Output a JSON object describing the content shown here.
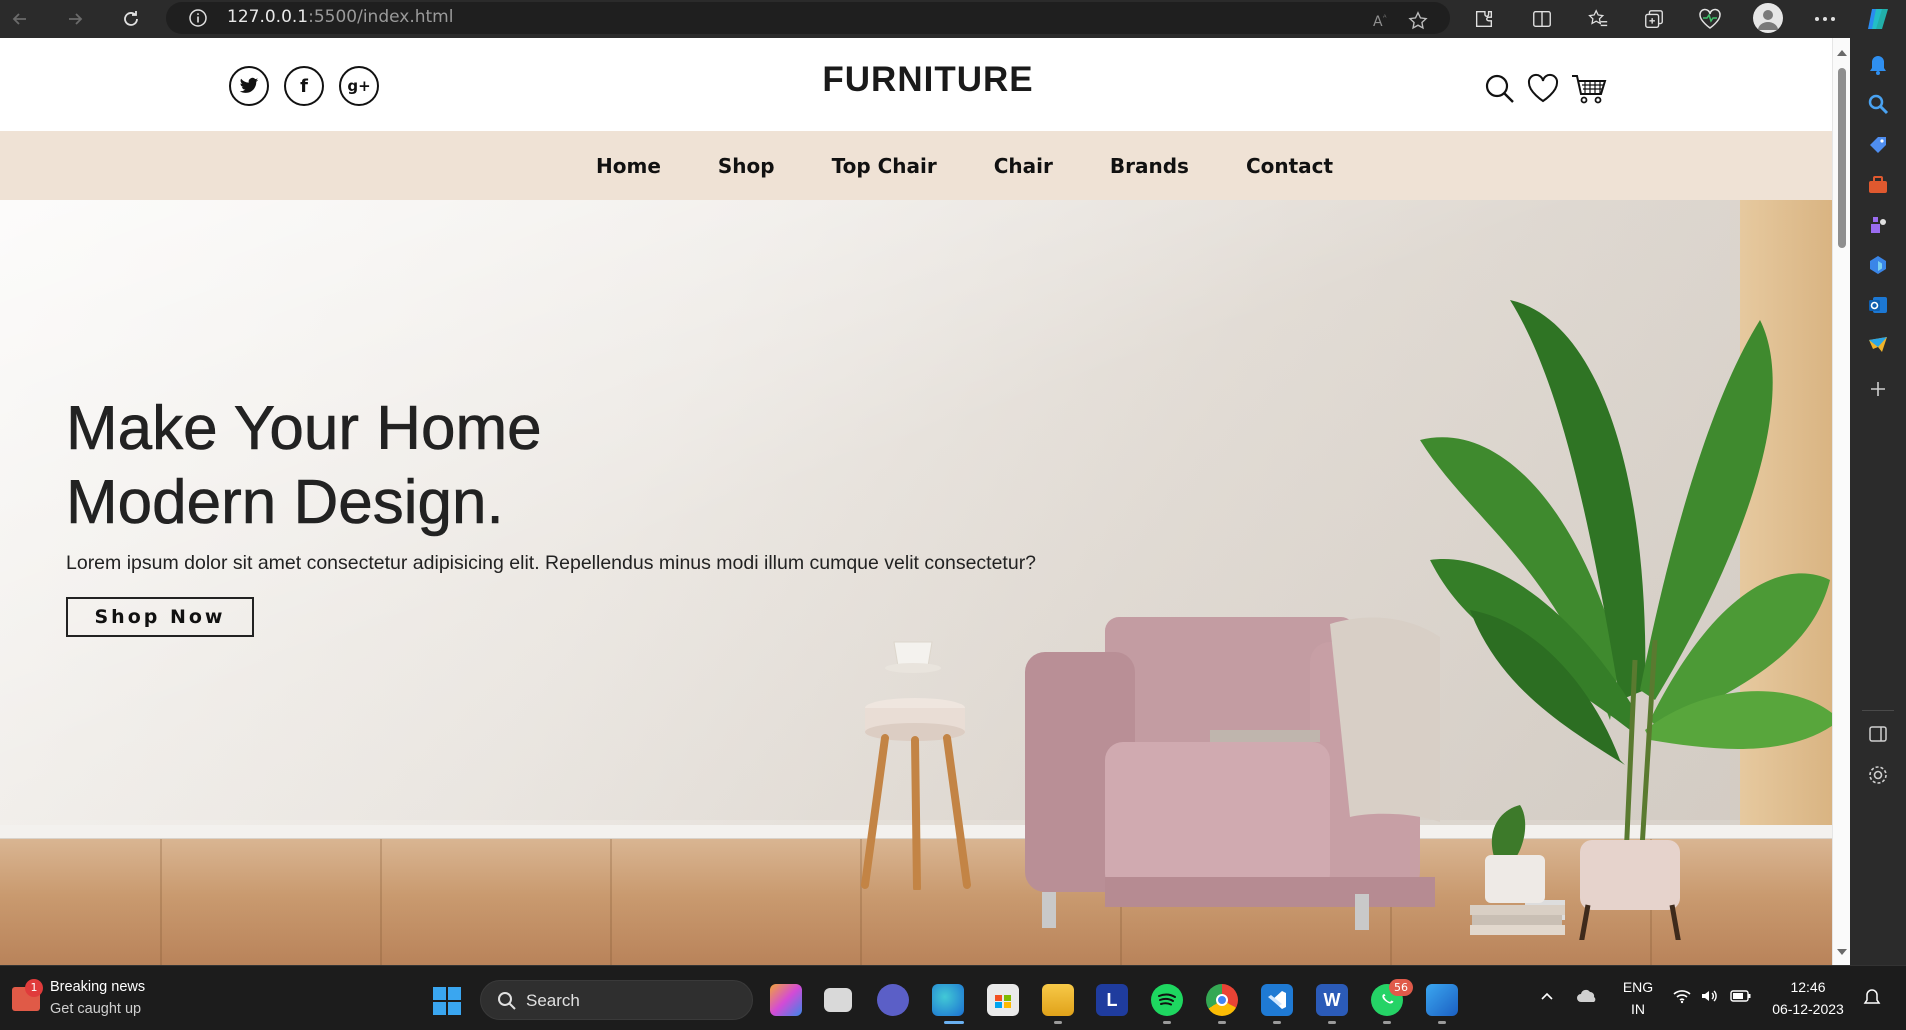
{
  "browser": {
    "url_host": "127.0.0.1",
    "url_rest": ":5500/index.html",
    "toolbar_icons": [
      "back-icon",
      "forward-icon",
      "refresh-icon",
      "info-icon",
      "read-aloud-icon",
      "favorite-star-icon",
      "extensions-icon",
      "split-screen-icon",
      "favorites-icon",
      "collections-icon",
      "performance-icon",
      "profile-icon",
      "more-icon",
      "copilot-icon"
    ]
  },
  "site": {
    "brand": "FURNITURE",
    "social": {
      "twitter_glyph": "🐦",
      "facebook_glyph": "f",
      "googleplus_glyph": "g+"
    },
    "nav": [
      "Home",
      "Shop",
      "Top Chair",
      "Chair",
      "Brands",
      "Contact"
    ],
    "hero": {
      "title_line1": "Make Your Home",
      "title_line2": "Modern Design.",
      "subtitle": "Lorem ipsum dolor sit amet consectetur adipisicing elit. Repellendus minus modi illum cumque velit consectetur?",
      "cta": "Shop Now"
    },
    "header_icons": [
      "search-icon",
      "heart-icon",
      "cart-icon"
    ]
  },
  "sidebar": {
    "icons": [
      "notification-icon",
      "search-icon",
      "shopping-tag-icon",
      "tools-icon",
      "games-icon",
      "copilot-icon",
      "outlook-icon",
      "telegram-icon",
      "add-icon",
      "panel-icon",
      "settings-icon"
    ]
  },
  "taskbar": {
    "news_title": "Breaking news",
    "news_subtitle": "Get caught up",
    "news_badge": "1",
    "search_placeholder": "Search",
    "whatsapp_badge": "56",
    "lang_line1": "ENG",
    "lang_line2": "IN",
    "time": "12:46",
    "date": "06-12-2023",
    "lens_label": "L"
  },
  "colors": {
    "nav_bg": "#efe2d5",
    "chair": "#c9a2a8",
    "plant": "#3f8a2e"
  }
}
